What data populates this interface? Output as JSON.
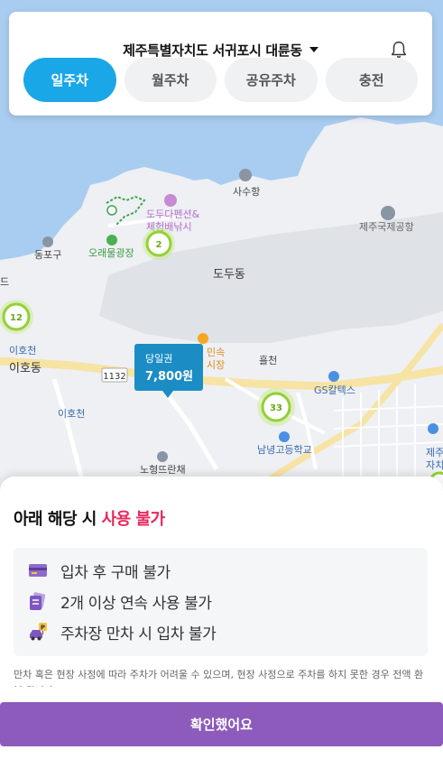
{
  "header": {
    "location": "제주특별자치도 서귀포시 대륜동",
    "tabs": [
      {
        "label": "일주차",
        "active": true
      },
      {
        "label": "월주차",
        "active": false
      },
      {
        "label": "공유주차",
        "active": false
      },
      {
        "label": "충전",
        "active": false
      }
    ]
  },
  "map": {
    "labels": {
      "dodu_pension": "도두다펜션&",
      "experience": "체험배낚시",
      "sisuhang": "사수항",
      "airport": "제주국제공항",
      "dongpogu": "동포구",
      "oraemul": "오래물광장",
      "dodudong": "도두동",
      "ihocheon1": "이호천",
      "ihodong": "이호동",
      "minsok1": "민속",
      "minsok2": "시장",
      "heulcheon": "흘천",
      "gs": "GS칼텍스",
      "road_1132": "1132",
      "ihocheon2": "이호천",
      "namnyeong": "남녕고등학교",
      "nohyeong": "노형뜨란채",
      "jeju1": "제주",
      "jeju2": "자치",
      "de": "드"
    },
    "clusters": {
      "c2": "2",
      "c12": "12",
      "c33": "33"
    },
    "price_pin": {
      "label": "당일권",
      "price": "7,800원"
    }
  },
  "sheet": {
    "title_prefix": "아래 해당 시 ",
    "title_highlight": "사용 불가",
    "rules": [
      {
        "text": "입차 후 구매 불가",
        "icon": "card-icon"
      },
      {
        "text": "2개 이상 연속 사용 불가",
        "icon": "tickets-icon"
      },
      {
        "text": "주차장 만차 시 입차 불가",
        "icon": "parking-car-icon"
      }
    ],
    "note": "만차 혹은 현장 사정에 따라 주차가 어려울 수 있으며, 현장 사정으로 주차를 하지 못한 경우 전액 환불 됩니다.",
    "confirm": "확인했어요"
  }
}
